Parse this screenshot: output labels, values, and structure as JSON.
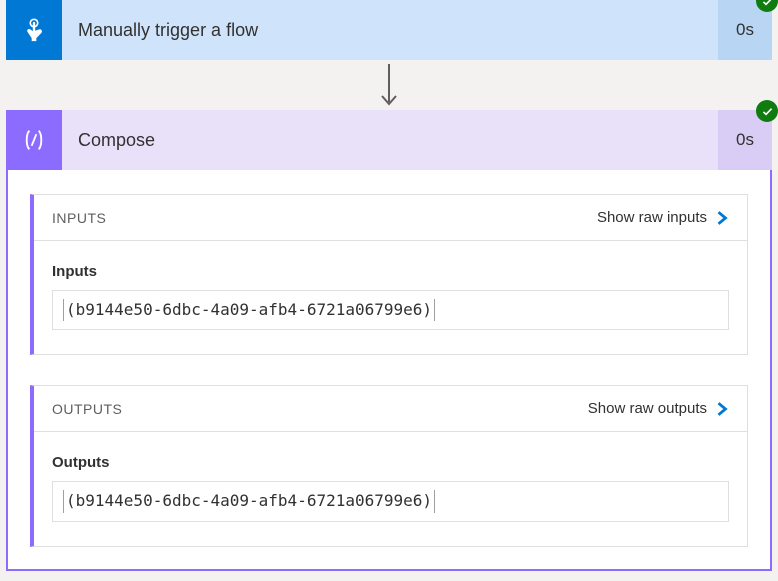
{
  "trigger": {
    "title": "Manually trigger a flow",
    "duration": "0s"
  },
  "compose": {
    "title": "Compose",
    "duration": "0s"
  },
  "sections": {
    "inputs": {
      "header": "INPUTS",
      "show_raw": "Show raw inputs",
      "field_label": "Inputs",
      "value": "(b9144e50-6dbc-4a09-afb4-6721a06799e6)"
    },
    "outputs": {
      "header": "OUTPUTS",
      "show_raw": "Show raw outputs",
      "field_label": "Outputs",
      "value": "(b9144e50-6dbc-4a09-afb4-6721a06799e6)"
    }
  }
}
